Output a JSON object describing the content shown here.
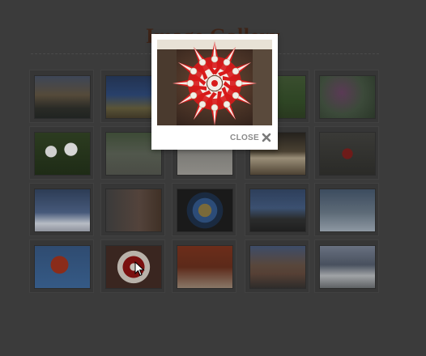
{
  "page": {
    "title": "Image Gallery"
  },
  "gallery": {
    "thumbnails": [
      {
        "icon": "sunset-photo"
      },
      {
        "icon": "beach-sunset-photo"
      },
      {
        "icon": "green-foliage-photo"
      },
      {
        "icon": "purple-flowers-photo"
      },
      {
        "icon": "daisies-photo"
      },
      {
        "icon": "tree-lined-road-photo"
      },
      {
        "icon": "stones-photo"
      },
      {
        "icon": "open-book-photo"
      },
      {
        "icon": "fire-hydrant-photo"
      },
      {
        "icon": "street-lamp-photo"
      },
      {
        "icon": "lantern-photo"
      },
      {
        "icon": "stained-glass-photo"
      },
      {
        "icon": "sea-horizon-photo"
      },
      {
        "icon": "interior-photo"
      },
      {
        "icon": "red-blossoms-photo"
      },
      {
        "icon": "red-white-decoration-photo"
      },
      {
        "icon": "red-buildings-photo"
      },
      {
        "icon": "harbour-town-photo"
      },
      {
        "icon": "snowy-mountains-photo"
      }
    ]
  },
  "lightbox": {
    "close_label": "CLOSE",
    "close_icon": "close-x-icon",
    "image_icon": "red-white-star-decoration-photo"
  },
  "colors": {
    "overlay": "#3b3b3b",
    "lightbox_bg": "#ffffff",
    "close_text": "#8a8a8a"
  }
}
